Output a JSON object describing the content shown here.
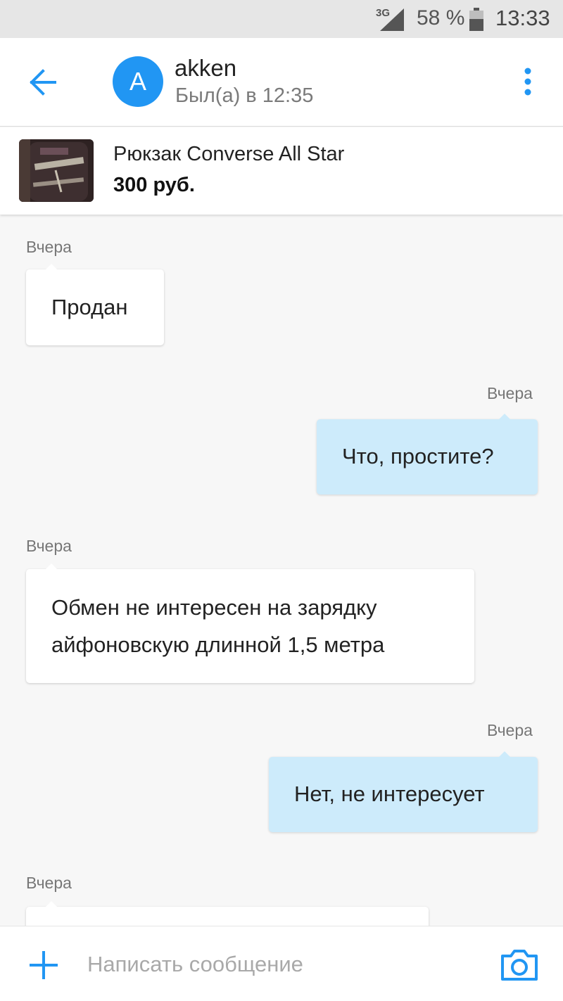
{
  "status_bar": {
    "network": "3G",
    "battery_percent": "58 %",
    "time": "13:33",
    "icons": [
      "signal-icon",
      "battery-icon"
    ]
  },
  "header": {
    "avatar_letter": "A",
    "name": "akken",
    "last_seen": "Был(а) в 12:35",
    "icons": [
      "back-arrow-icon",
      "more-vertical-icon"
    ],
    "accent_color": "#2196f3"
  },
  "product": {
    "title": "Рюкзак Converse All Star",
    "price": "300 руб."
  },
  "messages": [
    {
      "direction": "in",
      "time": "Вчера",
      "text": "Продан"
    },
    {
      "direction": "out",
      "time": "Вчера",
      "text": "Что, простите?"
    },
    {
      "direction": "in",
      "time": "Вчера",
      "lines": [
        "Обмен не интересен на зарядку",
        "айфоновскую длинной 1,5 метра"
      ]
    },
    {
      "direction": "out",
      "time": "Вчера",
      "text": "Нет, не интересует"
    },
    {
      "direction": "in",
      "time": "Вчера",
      "text": ""
    }
  ],
  "composer": {
    "placeholder": "Написать сообщение",
    "value": "",
    "icons": [
      "plus-icon",
      "camera-icon"
    ]
  },
  "colors": {
    "incoming_bubble": "#ffffff",
    "outgoing_bubble": "#cdebfb",
    "background": "#f7f7f7"
  }
}
